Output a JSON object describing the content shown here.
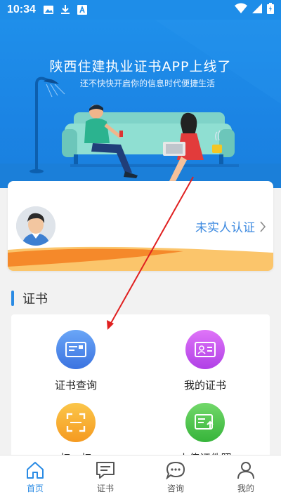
{
  "status_bar": {
    "time": "10:34"
  },
  "banner": {
    "title": "陕西住建执业证书APP上线了",
    "subtitle": "还不快快开启你的信息时代便捷生活"
  },
  "user_card": {
    "verify_label": "未实人认证"
  },
  "section": {
    "title": "证书"
  },
  "grid": {
    "items": [
      {
        "label": "证书查询",
        "icon": "id-card-icon",
        "color": "#4f8ef0"
      },
      {
        "label": "我的证书",
        "icon": "certificate-icon",
        "color": "#c24cf0"
      },
      {
        "label": "扫一扫",
        "icon": "scan-icon",
        "color": "#f5a623"
      },
      {
        "label": "上传证件照",
        "icon": "upload-photo-icon",
        "color": "#4cc24c"
      }
    ]
  },
  "tabbar": {
    "tabs": [
      {
        "label": "首页",
        "icon": "home-icon",
        "active": true
      },
      {
        "label": "证书",
        "icon": "certificate-message-icon",
        "active": false
      },
      {
        "label": "咨询",
        "icon": "chat-bubble-icon",
        "active": false
      },
      {
        "label": "我的",
        "icon": "user-icon",
        "active": false
      }
    ]
  },
  "colors": {
    "primary": "#2a8be4",
    "banner": "#1f8fea",
    "annotation": "#e02020"
  }
}
